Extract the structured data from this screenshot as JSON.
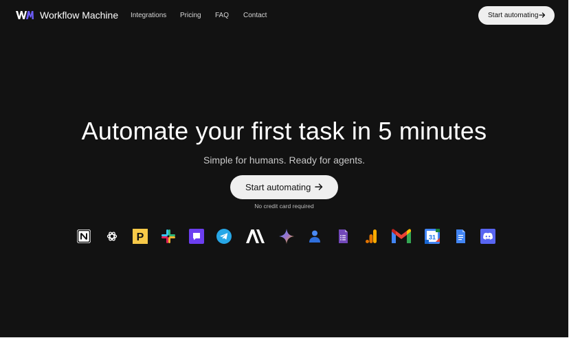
{
  "nav": {
    "logo_mark": "WM",
    "brand": "Workflow Machine",
    "links": [
      "Integrations",
      "Pricing",
      "FAQ",
      "Contact"
    ],
    "cta_label": "Start automating"
  },
  "hero": {
    "headline": "Automate your first task in 5 minutes",
    "subhead": "Simple for humans. Ready for agents.",
    "cta_label": "Start automating",
    "note": "No credit card required"
  },
  "integrations": [
    "notion-icon",
    "openai-icon",
    "producthunt-icon",
    "slack-icon",
    "chat-icon",
    "telegram-icon",
    "anthropic-icon",
    "gemini-icon",
    "contact-icon",
    "google-forms-icon",
    "google-analytics-icon",
    "gmail-icon",
    "google-calendar-icon",
    "google-docs-icon",
    "discord-icon"
  ],
  "icon_text": {
    "producthunt": "P",
    "anthropic": "A",
    "calendar_day": "31"
  },
  "colors": {
    "background": "#121212",
    "button_bg": "#efefef",
    "accent_logo": "#6b5cf6"
  }
}
